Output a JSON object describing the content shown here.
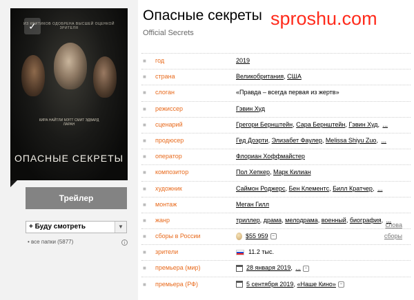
{
  "movie": {
    "title": "Опасные секреты",
    "original_title": "Official Secrets"
  },
  "watermark": "sproshu.com",
  "poster": {
    "top_text": "ИЗ КРИТИКОВ ОДОБРЕНА ВЫСШЕЙ ОЦЕНКОЙ ЗРИТЕЛЯ",
    "cast_text": "КИРА НАЙТЛИ МЭТТ СМИТ ЭДВАРД ЛАРАН",
    "title_text": "ОПАСНЫЕ СЕКРЕТЫ",
    "check_icon": "check-icon"
  },
  "sidebar": {
    "trailer_label": "Трейлер",
    "watch_label": "+ Буду смотреть",
    "folders_label": "• все папки (5877)",
    "info_icon": "i"
  },
  "info": {
    "year": {
      "label": "год",
      "value": "2019"
    },
    "country": {
      "label": "страна",
      "values": [
        "Великобритания",
        "США"
      ]
    },
    "slogan": {
      "label": "слоган",
      "value": "«Правда – всегда первая из жертв»"
    },
    "director": {
      "label": "режиссер",
      "value": "Гэвин Худ"
    },
    "writers": {
      "label": "сценарий",
      "values": [
        "Грегори Бернштейн",
        "Сара Бернштейн",
        "Гэвин Худ"
      ],
      "more": "..."
    },
    "producers": {
      "label": "продюсер",
      "values": [
        "Гед Доэрти",
        "Элизабет Фаулер",
        "Melissa Shiyu Zuo"
      ],
      "more": "..."
    },
    "operator": {
      "label": "оператор",
      "value": "Флориан Хоффмайстер"
    },
    "composer": {
      "label": "композитор",
      "values": [
        "Пол Хепкер",
        "Марк Килиан"
      ]
    },
    "artist": {
      "label": "художник",
      "values": [
        "Саймон Роджерс",
        "Бен Клементс",
        "Билл Кратчер"
      ],
      "more": "..."
    },
    "editing": {
      "label": "монтаж",
      "value": "Меган Гилл"
    },
    "genre": {
      "label": "жанр",
      "values": [
        "триллер",
        "драма",
        "мелодрама",
        "военный",
        "биография"
      ],
      "more": "...",
      "extra_link": "слова"
    },
    "box_office": {
      "label": "сборы в России",
      "value": "$55 959",
      "icon": "minus-icon",
      "extra_link": "сборы"
    },
    "viewers": {
      "label": "зрители",
      "value": "11.2 тыс."
    },
    "premiere_world": {
      "label": "премьера (мир)",
      "value": "28 января 2019",
      "more": "...",
      "icon": "minus-icon"
    },
    "premiere_rf": {
      "label": "премьера (РФ)",
      "value": "5 сентября 2019",
      "distributor": "«Наше Кино»",
      "icon": "minus-icon"
    }
  }
}
